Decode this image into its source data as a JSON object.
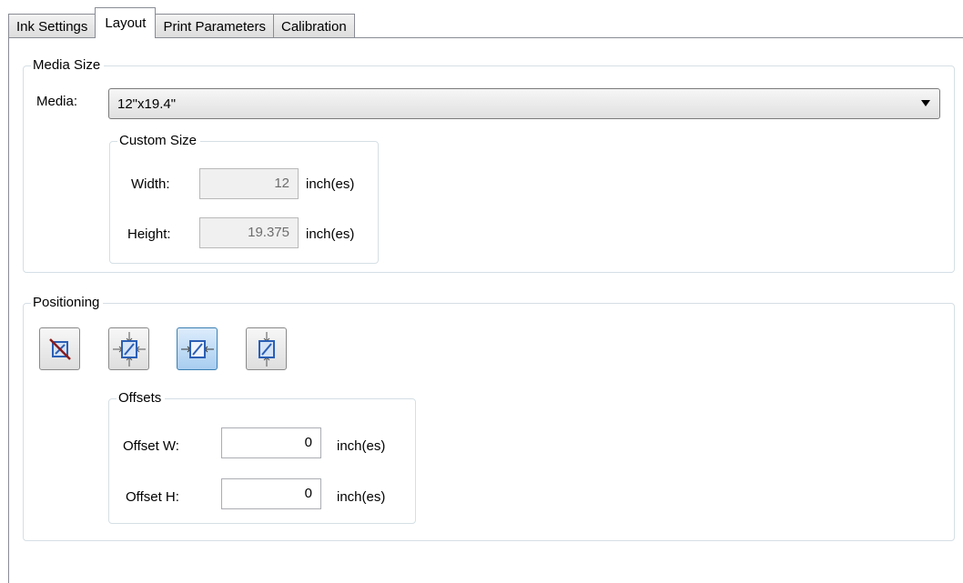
{
  "tabs": [
    {
      "label": "Ink Settings",
      "active": false
    },
    {
      "label": "Layout",
      "active": true
    },
    {
      "label": "Print Parameters",
      "active": false
    },
    {
      "label": "Calibration",
      "active": false
    }
  ],
  "media_size": {
    "group_title": "Media Size",
    "media_label": "Media:",
    "media_value": "12\"x19.4\"",
    "custom_size": {
      "group_title": "Custom Size",
      "width_label": "Width:",
      "width_value": "12",
      "width_unit": "inch(es)",
      "height_label": "Height:",
      "height_value": "19.375",
      "height_unit": "inch(es)"
    }
  },
  "positioning": {
    "group_title": "Positioning",
    "buttons": [
      {
        "icon": "no-positioning-icon",
        "selected": false
      },
      {
        "icon": "center-both-icon",
        "selected": false
      },
      {
        "icon": "center-horizontal-icon",
        "selected": true
      },
      {
        "icon": "center-vertical-icon",
        "selected": false
      }
    ],
    "offsets": {
      "group_title": "Offsets",
      "offset_w_label": "Offset W:",
      "offset_w_value": "0",
      "offset_w_unit": "inch(es)",
      "offset_h_label": "Offset H:",
      "offset_h_value": "0",
      "offset_h_unit": "inch(es)"
    }
  },
  "colors": {
    "selected_button": "#a8cdf0",
    "icon_blue": "#2b5fb5",
    "icon_red": "#c0282a"
  }
}
